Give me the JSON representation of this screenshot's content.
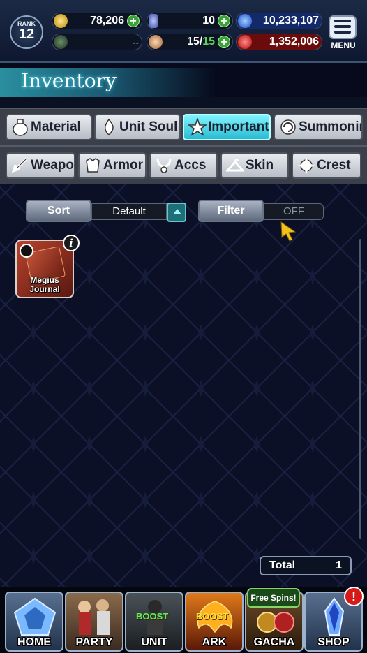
{
  "hud": {
    "rank_label": "RANK",
    "rank_value": "12",
    "gil": "78,206",
    "crystals": "10",
    "lapis": "10,233,107",
    "blank_stat": "--",
    "storage": "15/",
    "storage_max": "15",
    "visions": "1,352,006",
    "menu_label": "MENU"
  },
  "title": "Inventory",
  "tabs_row1": [
    "Material",
    "Unit Soul",
    "Important",
    "Summoning"
  ],
  "tabs_row2": [
    "Weapon",
    "Armor",
    "Accs",
    "Skin",
    "Crest"
  ],
  "active_tab": "Important",
  "controls": {
    "sort_label": "Sort",
    "sort_value": "Default",
    "filter_label": "Filter",
    "filter_value": "OFF"
  },
  "items": [
    {
      "name_line1": "Megius",
      "name_line2": "Journal"
    }
  ],
  "total_label": "Total",
  "total_value": "1",
  "nav": {
    "home": "HOME",
    "party": "PARTY",
    "unit": "UNIT",
    "ark": "ARK",
    "gacha": "GACHA",
    "shop": "SHOP",
    "boost": "BOOST",
    "free_spins": "Free Spins!",
    "alert": "!"
  },
  "colors": {
    "active_tab": "#2bbbd2",
    "plus_button": "#3aa238",
    "gil_icon": "#d9b12a",
    "lapis_icon": "#2b6ff0",
    "visions_icon": "#e01c1c",
    "alert_badge": "#d61a1a"
  }
}
